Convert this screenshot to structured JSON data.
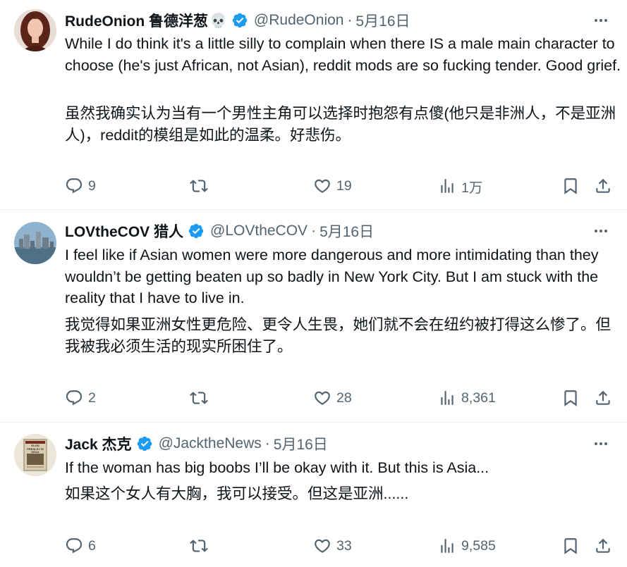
{
  "tweets": [
    {
      "display_name": "RudeOnion 鲁德洋葱",
      "emoji": "💀",
      "handle": "@RudeOnion",
      "separator": "·",
      "date": "5月16日",
      "text": "While I do think it's a little silly to complain when there IS a male main character to choose (he's just African, not Asian), reddit mods are so fucking tender. Good grief.",
      "translation": "虽然我确实认为当有一个男性主角可以选择时抱怨有点傻(他只是非洲人，不是亚洲人)，reddit的模组是如此的温柔。好悲伤。",
      "replies": "9",
      "retweets": "",
      "likes": "19",
      "views": "1万"
    },
    {
      "display_name": "LOVtheCOV 猎人",
      "handle": "@LOVtheCOV",
      "separator": "·",
      "date": "5月16日",
      "text": "I feel like if Asian women were more dangerous and more intimidating than they wouldn’t be getting beaten up so badly in New York City. But I am stuck with the reality that I have to live in.",
      "translation": "我觉得如果亚洲女性更危险、更令人生畏，她们就不会在纽约被打得这么惨了。但我被我必须生活的现实所困住了。",
      "replies": "2",
      "retweets": "",
      "likes": "28",
      "views": "8,361"
    },
    {
      "display_name": "Jack 杰克",
      "handle": "@JacktheNews",
      "separator": "·",
      "date": "5月16日",
      "text": "If the woman has big boobs I’ll be okay with it. But this is Asia...",
      "translation": "如果这个女人有大胸，我可以接受。但这是亚洲......",
      "replies": "6",
      "retweets": "",
      "likes": "33",
      "views": "9,585"
    }
  ],
  "avatar_3_text": "ELVIS PRESLEY IS DEAD",
  "colors": {
    "text": "#0f1419",
    "muted": "#536471",
    "verified": "#1d9bf0",
    "divider": "#eff3f4"
  },
  "icons": [
    "reply-icon",
    "retweet-icon",
    "like-icon",
    "views-icon",
    "bookmark-icon",
    "share-icon",
    "more-icon",
    "verified-badge-icon"
  ]
}
